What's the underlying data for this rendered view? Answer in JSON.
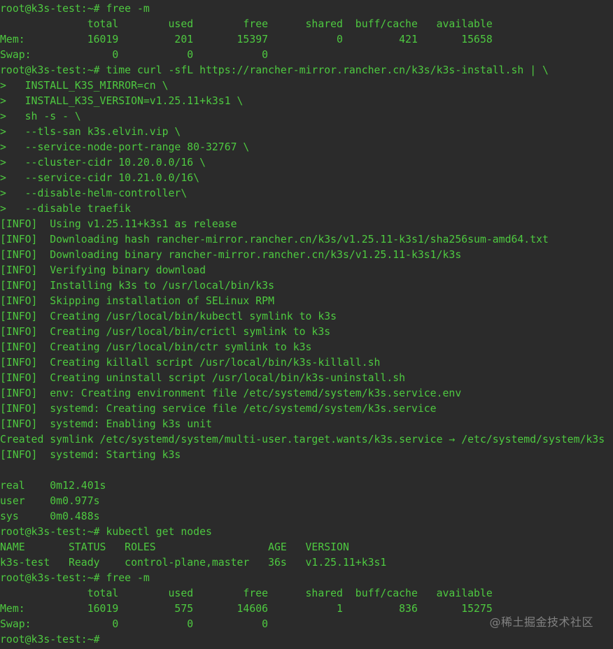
{
  "colors": {
    "background": "#2b2b2b",
    "foreground": "#4ec940",
    "watermark": "#bdbdbd"
  },
  "terminal": {
    "lines": [
      "root@k3s-test:~# free -m",
      "              total        used        free      shared  buff/cache   available",
      "Mem:          16019         201       15397           0         421       15658",
      "Swap:             0           0           0",
      "root@k3s-test:~# time curl -sfL https://rancher-mirror.rancher.cn/k3s/k3s-install.sh | \\",
      ">   INSTALL_K3S_MIRROR=cn \\",
      ">   INSTALL_K3S_VERSION=v1.25.11+k3s1 \\",
      ">   sh -s - \\",
      ">   --tls-san k3s.elvin.vip \\",
      ">   --service-node-port-range 80-32767 \\",
      ">   --cluster-cidr 10.20.0.0/16 \\",
      ">   --service-cidr 10.21.0.0/16\\",
      ">   --disable-helm-controller\\",
      ">   --disable traefik",
      "[INFO]  Using v1.25.11+k3s1 as release",
      "[INFO]  Downloading hash rancher-mirror.rancher.cn/k3s/v1.25.11-k3s1/sha256sum-amd64.txt",
      "[INFO]  Downloading binary rancher-mirror.rancher.cn/k3s/v1.25.11-k3s1/k3s",
      "[INFO]  Verifying binary download",
      "[INFO]  Installing k3s to /usr/local/bin/k3s",
      "[INFO]  Skipping installation of SELinux RPM",
      "[INFO]  Creating /usr/local/bin/kubectl symlink to k3s",
      "[INFO]  Creating /usr/local/bin/crictl symlink to k3s",
      "[INFO]  Creating /usr/local/bin/ctr symlink to k3s",
      "[INFO]  Creating killall script /usr/local/bin/k3s-killall.sh",
      "[INFO]  Creating uninstall script /usr/local/bin/k3s-uninstall.sh",
      "[INFO]  env: Creating environment file /etc/systemd/system/k3s.service.env",
      "[INFO]  systemd: Creating service file /etc/systemd/system/k3s.service",
      "[INFO]  systemd: Enabling k3s unit",
      "Created symlink /etc/systemd/system/multi-user.target.wants/k3s.service → /etc/systemd/system/k3s",
      "[INFO]  systemd: Starting k3s",
      "",
      "real    0m12.401s",
      "user    0m0.977s",
      "sys     0m0.488s",
      "root@k3s-test:~# kubectl get nodes",
      "NAME       STATUS   ROLES                  AGE   VERSION",
      "k3s-test   Ready    control-plane,master   36s   v1.25.11+k3s1",
      "root@k3s-test:~# free -m",
      "              total        used        free      shared  buff/cache   available",
      "Mem:          16019         575       14606           1         836       15275",
      "Swap:             0           0           0",
      "root@k3s-test:~# "
    ]
  },
  "watermark": {
    "text": "@稀土掘金技术社区"
  }
}
